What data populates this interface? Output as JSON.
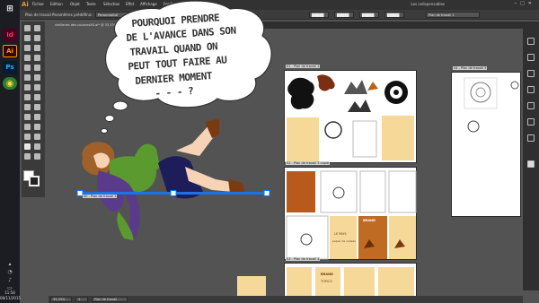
{
  "taskbar": {
    "icons": [
      {
        "name": "windows-start-icon",
        "label": "⊞",
        "color": "#1b1d22"
      },
      {
        "name": "indesign-icon",
        "label": "Id",
        "color": "#49021f"
      },
      {
        "name": "illustrator-icon",
        "label": "Ai",
        "color": "#330000"
      },
      {
        "name": "photoshop-icon",
        "label": "Ps",
        "color": "#001d34"
      },
      {
        "name": "chrome-icon",
        "label": "◉",
        "color": "#2e7d32"
      }
    ],
    "time": "11:58",
    "date": "08/11/2015"
  },
  "menubar": {
    "app_logo": "Ai",
    "items": [
      "Fichier",
      "Edition",
      "Objet",
      "Texte",
      "Sélection",
      "Effet",
      "Affichage",
      "Fenêtre",
      "Aide"
    ],
    "workspace": "Les indispensables"
  },
  "controlbar": {
    "selection": "Plan de travail",
    "preset_label": "Paramètres prédéfinis :",
    "preset_value": "Personnalisé",
    "fields": [
      "█████",
      "█████",
      "█████",
      "█████"
    ],
    "artboard_name": "Plan de travail 1"
  },
  "document": {
    "tab_title": "vieilleries des cuisinesXX.ai* @ 33,33% (RVB/Aperçu)"
  },
  "thought": {
    "lines": [
      "POURQUOI PRENDRE",
      "DE L'AVANCE DANS SON",
      "TRAVAIL QUAND ON",
      "PEUT TOUT FAIRE AU",
      "DERNIER MOMENT",
      "- - - ?"
    ]
  },
  "artboards": {
    "main_label": "00 - Plan de travail 1",
    "ab1_label": "01 - Plan de travail 2",
    "ab2_label": "02 - Plan de travail 3 copie",
    "ab3_label": "03 - Plan de travail 4",
    "ab4_label": "04 - Plan de travail 5",
    "ab5_label": "05 - Plan de travail 5 copie"
  },
  "tiles": {
    "brand": "BRAND",
    "title": "LE PAYS",
    "subtitle": "papier de cadeau",
    "brand2": "BRAND",
    "title2": "TOPICS"
  },
  "statusbar": {
    "zoom": "33,33%",
    "page": "1",
    "tool": "Plan de travail"
  },
  "colors": {
    "wood": "#f6d899",
    "brown": "#b5651d",
    "accent": "#1a73e8"
  }
}
